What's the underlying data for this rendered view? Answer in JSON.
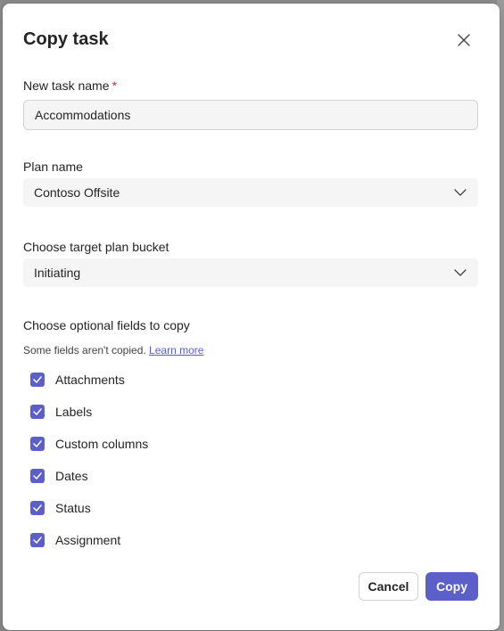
{
  "dialog": {
    "title": "Copy task",
    "close_label": "Close"
  },
  "fields": {
    "task_name": {
      "label": "New task name",
      "required_mark": "*",
      "value": "Accommodations"
    },
    "plan_name": {
      "label": "Plan name",
      "value": "Contoso Offsite"
    },
    "bucket": {
      "label": "Choose target plan bucket",
      "value": "Initiating"
    }
  },
  "optional": {
    "title": "Choose optional fields to copy",
    "hint": "Some fields aren't copied.",
    "learn_more": "Learn more",
    "items": [
      {
        "label": "Attachments",
        "checked": true
      },
      {
        "label": "Labels",
        "checked": true
      },
      {
        "label": "Custom columns",
        "checked": true
      },
      {
        "label": "Dates",
        "checked": true
      },
      {
        "label": "Status",
        "checked": true
      },
      {
        "label": "Assignment",
        "checked": true
      }
    ]
  },
  "buttons": {
    "cancel": "Cancel",
    "copy": "Copy"
  },
  "colors": {
    "accent": "#5b5fc7",
    "required": "#c4314b"
  },
  "icons": {
    "close": "close-icon",
    "dropdown": "chevron-down-icon",
    "check": "checkmark-icon"
  }
}
